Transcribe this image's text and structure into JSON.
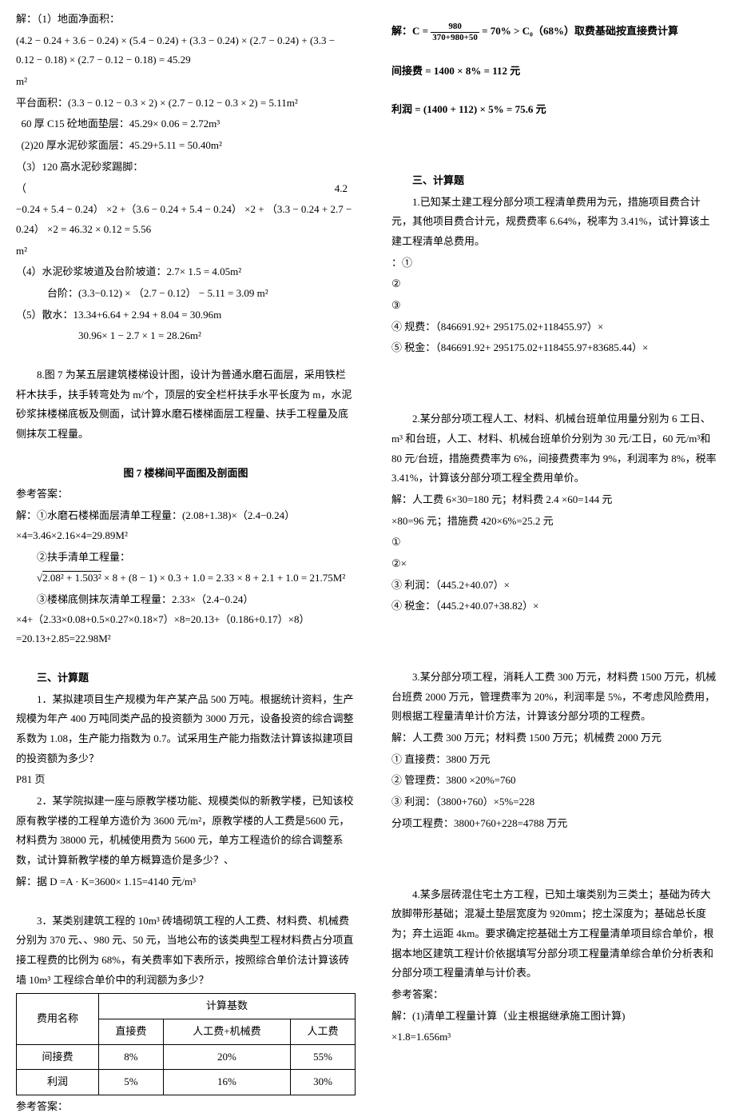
{
  "left": {
    "l1": "解：（1）地面净面积：",
    "l2": "(4.2 − 0.24 + 3.6 − 0.24) × (5.4 − 0.24) + (3.3 − 0.24) × (2.7 − 0.24) + (3.3 − 0.12 − 0.18) × (2.7 − 0.12 − 0.18) = 45.29",
    "l3": "m²",
    "l4": "平台面积：(3.3 − 0.12 − 0.3 × 2) × (2.7 − 0.12 − 0.3 × 2) = 5.11m²",
    "l5a": "60 厚 C15 砼地面垫层：45.29× 0.06 = 2.72m³",
    "l5b": "(2)20 厚水泥砂浆面层：45.29+5.11 = 50.40m²",
    "l6": "（3）120 高水泥砂浆踢脚：",
    "l7a": "（",
    "l7b": "4.2",
    "l8": "−0.24 + 5.4 − 0.24） ×2 +（3.6 − 0.24 + 5.4 − 0.24） ×2 + （3.3 − 0.24 + 2.7 − 0.24） ×2 = 46.32 × 0.12 = 5.56",
    "l9": "m²",
    "l10": "（4）水泥砂浆坡道及台阶坡道：2.7× 1.5 = 4.05m²",
    "l11": "台阶：(3.3−0.12) × （2.7 − 0.12） − 5.11 = 3.09 m²",
    "l12": "（5）散水：13.34+6.64 + 2.94 + 8.04 = 30.96m",
    "l13": "30.96× 1 − 2.7 × 1 = 28.26m²",
    "p8": "8.图 7 为某五层建筑楼梯设计图，设计为普通水磨石面层，采用铁栏杆木扶手，扶手转弯处为 m/个，顶层的安全栏杆扶手水平长度为 m，水泥砂浆抹楼梯底板及侧面，试计算水磨石楼梯面层工程量、扶手工程量及底侧抹灰工程量。",
    "fig": "图 7 楼梯间平面图及剖面图",
    "ans": "参考答案：",
    "a1": "解：①水磨石楼梯面层清单工程量：(2.08+1.38)×（2.4−0.24）×4=3.46×2.16×4=29.89M²",
    "a2": "②扶手清单工程量：",
    "a3pre": "√",
    "a3sq": "2.08² + 1.503²",
    "a3post": " × 8 + (8 − 1) × 0.3 + 1.0 = 2.33 × 8 + 2.1 + 1.0 = 21.75M²",
    "a4": "③楼梯底侧抹灰清单工程量：2.33×（2.4−0.24）×4+（2.33×0.08+0.5×0.27×0.18×7）×8=20.13+（0.186+0.17）×8）=20.13+2.85=22.98M²",
    "sec3": "三、计算题",
    "q1": "1．某拟建项目生产规模为年产某产品 500 万吨。根据统计资料，生产规模为年产 400 万吨同类产品的投资额为 3000 万元，设备投资的综合调整系数为 1.08，生产能力指数为 0.7。试采用生产能力指数法计算该拟建项目的投资额为多少？",
    "p81": "P81 页",
    "q2": "2．某学院拟建一座与原教学楼功能、规模类似的新教学楼，已知该校原有教学楼的工程单方造价为 3600 元/m²，原教学楼的人工费是5600 元，材料费为 38000 元，机械使用费为 5600 元，单方工程造价的综合调整系数，试计算新教学楼的单方概算造价是多少？、",
    "q2s": "解：据 D =A · K=3600× 1.15=4140 元/m³",
    "q3": "3．某类别建筑工程的 10m³ 砖墙砌筑工程的人工费、材料费、机械费分别为 370 元、、980 元、50 元，当地公布的该类典型工程材料费占分项直接工程费的比例为 68%，有关费率如下表所示，按照综合单价法计算该砖墙 10m³ 工程综合单价中的利润额为多少？",
    "table": {
      "h1": "费用名称",
      "h2": "计算基数",
      "c1": "直接费",
      "c2": "人工费+机械费",
      "c3": "人工费",
      "r1": {
        "n": "间接费",
        "v1": "8%",
        "v2": "20%",
        "v3": "55%"
      },
      "r2": {
        "n": "利润",
        "v1": "5%",
        "v2": "16%",
        "v3": "30%"
      }
    },
    "ans2": "参考答案："
  },
  "right": {
    "r1a": "解：C = ",
    "r1nu": "980",
    "r1de": "370+980+50",
    "r1b": " = 70% > C₀（68%）取费基础按直接费计算",
    "r2": "间接费 = 1400 × 8% = 112 元",
    "r3": "利润 = (1400 + 112) × 5% = 75.6 元",
    "sec3": "三、计算题",
    "q1": "1.已知某土建工程分部分项工程清单费用为元，措施项目费合计元，其他项目费合计元，规费费率 6.64%，税率为 3.41%，试计算该土建工程清单总费用。",
    "q1a": "：①",
    "q1b": "②",
    "q1c": "③",
    "q1d": "④ 规费：（846691.92+ 295175.02+118455.97）×",
    "q1e": "⑤ 税金：（846691.92+ 295175.02+118455.97+83685.44）×",
    "q2": "2.某分部分项工程人工、材料、机械台班单位用量分别为 6 工日、m³ 和台班，人工、材料、机械台班单价分别为 30 元/工日，60 元/m³和 80 元/台班，措施费费率为 6%，间接费费率为 9%，利润率为 8%，税率 3.41%，计算该分部分项工程全费用单价。",
    "q2s1": "解：人工费 6×30=180 元；材料费 2.4 ×60=144 元",
    "q2s2": "×80=96 元；措施费 420×6%=25.2 元",
    "q2s3": "①",
    "q2s4": "②×",
    "q2s5": "③ 利润：（445.2+40.07）×",
    "q2s6": "④ 税金：（445.2+40.07+38.82）×",
    "q3": "3.某分部分项工程，消耗人工费 300 万元，材料费 1500 万元，机械台班费 2000 万元，管理费率为 20%，利润率是 5%，不考虑风险费用，则根据工程量清单计价方法，计算该分部分项的工程费。",
    "q3s1": "解：人工费 300 万元；材料费 1500 万元；机械费 2000 万元",
    "q3s2": "① 直接费：3800 万元",
    "q3s3": "② 管理费：3800 ×20%=760",
    "q3s4": "③ 利润：（3800+760）×5%=228",
    "q3s5": "分项工程费：3800+760+228=4788 万元",
    "q4": "4.某多层砖混住宅土方工程，已知土壤类别为三类土；基础为砖大放脚带形基础；混凝土垫层宽度为 920mm；挖土深度为；基础总长度为；弃土运距 4km。要求确定挖基础土方工程量清单项目综合单价，根据本地区建筑工程计价依据填写分部分项工程量清单综合单价分析表和分部分项工程量清单与计价表。",
    "q4a": "参考答案：",
    "q4s1": "解：(1)清单工程量计算（业主根据继承施工图计算)",
    "q4s2": "×1.8=1.656m³"
  }
}
